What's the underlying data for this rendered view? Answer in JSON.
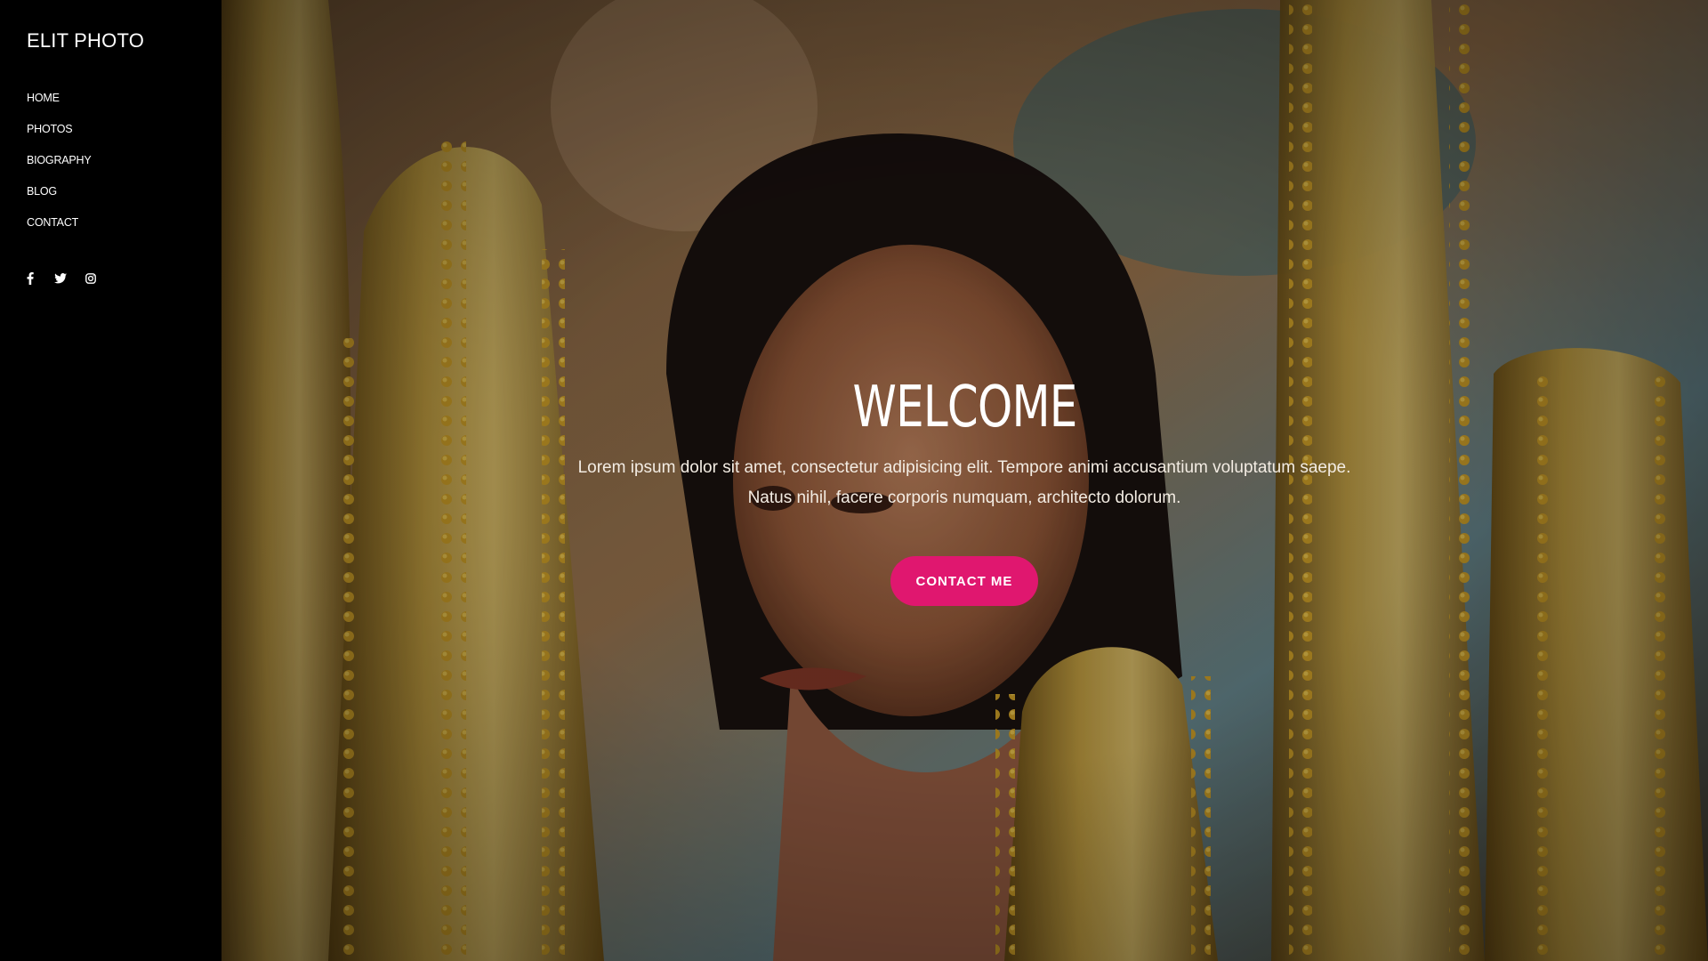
{
  "brand": {
    "name": "ELIT PHOTO"
  },
  "nav": {
    "items": [
      {
        "label": "HOME"
      },
      {
        "label": "PHOTOS"
      },
      {
        "label": "BIOGRAPHY"
      },
      {
        "label": "BLOG"
      },
      {
        "label": "CONTACT"
      }
    ]
  },
  "social": {
    "icons": [
      "facebook-icon",
      "twitter-icon",
      "instagram-icon"
    ]
  },
  "hero": {
    "title": "WELCOME",
    "text_line1": "Lorem ipsum dolor sit amet, consectetur adipisicing elit. Tempore animi accusantium voluptatum saepe.",
    "text_line2": "Natus nihil, facere corporis numquam, architecto dolorum.",
    "cta_label": "CONTACT ME"
  },
  "colors": {
    "sidebar_bg": "#000000",
    "accent": "#e0176f",
    "text": "#ffffff"
  }
}
